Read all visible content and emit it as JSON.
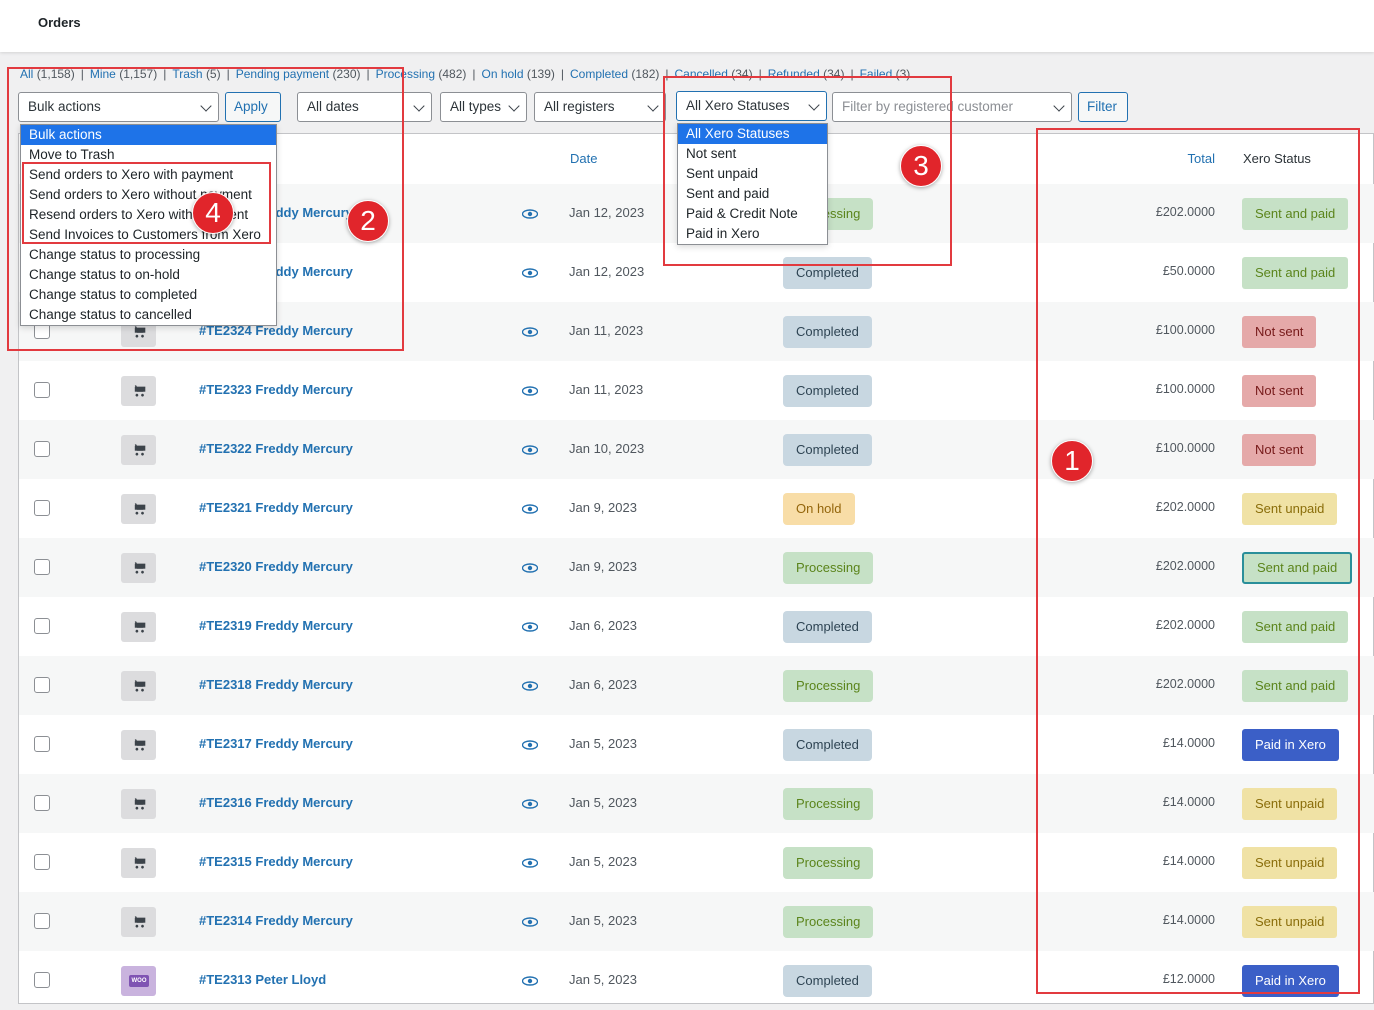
{
  "header": {
    "title": "Orders"
  },
  "views": [
    {
      "label": "All",
      "count": "(1,158)"
    },
    {
      "label": "Mine",
      "count": "(1,157)"
    },
    {
      "label": "Trash",
      "count": "(5)"
    },
    {
      "label": "Pending payment",
      "count": "(230)"
    },
    {
      "label": "Processing",
      "count": "(482)"
    },
    {
      "label": "On hold",
      "count": "(139)"
    },
    {
      "label": "Completed",
      "count": "(182)"
    },
    {
      "label": "Cancelled",
      "count": "(34)"
    },
    {
      "label": "Refunded",
      "count": "(34)"
    },
    {
      "label": "Failed",
      "count": "(3)"
    }
  ],
  "toolbar": {
    "bulk_actions": "Bulk actions",
    "apply": "Apply",
    "dates": "All dates",
    "types": "All types",
    "registers": "All registers",
    "xero_statuses": "All Xero Statuses",
    "customer_placeholder": "Filter by registered customer",
    "filter": "Filter"
  },
  "bulk_menu": [
    "Bulk actions",
    "Move to Trash",
    "Send orders to Xero with payment",
    "Send orders to Xero without payment",
    "Resend orders to Xero with payment",
    "Send Invoices to Customers from Xero",
    "Change status to processing",
    "Change status to on-hold",
    "Change status to completed",
    "Change status to cancelled"
  ],
  "xero_menu": [
    "All Xero Statuses",
    "Not sent",
    "Sent unpaid",
    "Sent and paid",
    "Paid & Credit Note",
    "Paid in Xero"
  ],
  "columns": {
    "date": "Date",
    "total": "Total",
    "xero_status": "Xero Status"
  },
  "rows": [
    {
      "order": "#TE2326 Freddy Mercury",
      "date": "Jan 12, 2023",
      "status": "Processing",
      "total": "£202.0000",
      "xero": "Sent and paid"
    },
    {
      "order": "#TE2325 Freddy Mercury",
      "date": "Jan 12, 2023",
      "status": "Completed",
      "total": "£50.0000",
      "xero": "Sent and paid"
    },
    {
      "order": "#TE2324 Freddy Mercury",
      "date": "Jan 11, 2023",
      "status": "Completed",
      "total": "£100.0000",
      "xero": "Not sent"
    },
    {
      "order": "#TE2323 Freddy Mercury",
      "date": "Jan 11, 2023",
      "status": "Completed",
      "total": "£100.0000",
      "xero": "Not sent"
    },
    {
      "order": "#TE2322 Freddy Mercury",
      "date": "Jan 10, 2023",
      "status": "Completed",
      "total": "£100.0000",
      "xero": "Not sent"
    },
    {
      "order": "#TE2321 Freddy Mercury",
      "date": "Jan 9, 2023",
      "status": "On hold",
      "total": "£202.0000",
      "xero": "Sent unpaid"
    },
    {
      "order": "#TE2320 Freddy Mercury",
      "date": "Jan 9, 2023",
      "status": "Processing",
      "total": "£202.0000",
      "xero": "Sent and paid"
    },
    {
      "order": "#TE2319 Freddy Mercury",
      "date": "Jan 6, 2023",
      "status": "Completed",
      "total": "£202.0000",
      "xero": "Sent and paid"
    },
    {
      "order": "#TE2318 Freddy Mercury",
      "date": "Jan 6, 2023",
      "status": "Processing",
      "total": "£202.0000",
      "xero": "Sent and paid"
    },
    {
      "order": "#TE2317 Freddy Mercury",
      "date": "Jan 5, 2023",
      "status": "Completed",
      "total": "£14.0000",
      "xero": "Paid in Xero"
    },
    {
      "order": "#TE2316 Freddy Mercury",
      "date": "Jan 5, 2023",
      "status": "Processing",
      "total": "£14.0000",
      "xero": "Sent unpaid"
    },
    {
      "order": "#TE2315 Freddy Mercury",
      "date": "Jan 5, 2023",
      "status": "Processing",
      "total": "£14.0000",
      "xero": "Sent unpaid"
    },
    {
      "order": "#TE2314 Freddy Mercury",
      "date": "Jan 5, 2023",
      "status": "Processing",
      "total": "£14.0000",
      "xero": "Sent unpaid"
    },
    {
      "order": "#TE2313 Peter Lloyd",
      "date": "Jan 5, 2023",
      "status": "Completed",
      "total": "£12.0000",
      "xero": "Paid in Xero"
    }
  ],
  "woo_badge": "WOO",
  "markers": [
    "1",
    "2",
    "3",
    "4"
  ],
  "colors": {
    "highlight": "#e23a3f",
    "link": "#2271b1",
    "paid_in_xero": "#3b5fc7"
  }
}
